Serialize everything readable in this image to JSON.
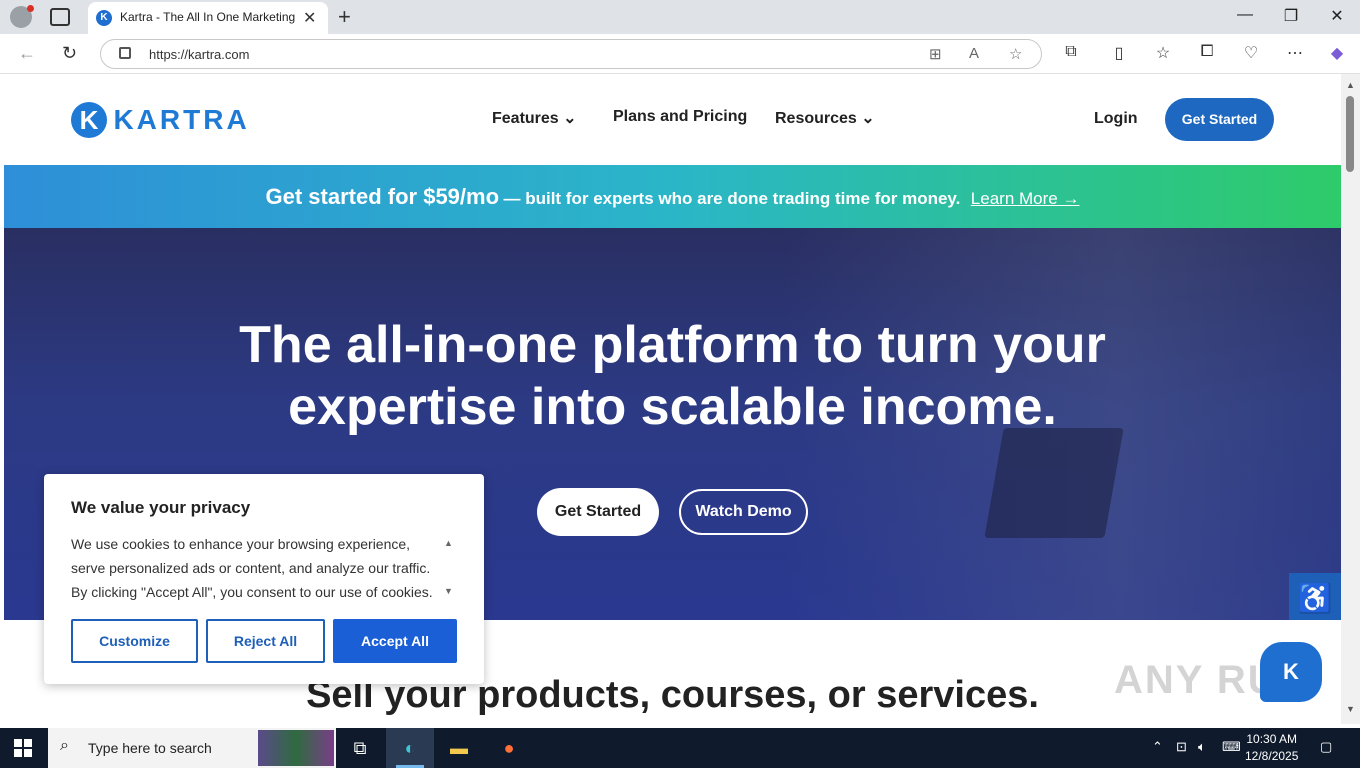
{
  "browser": {
    "tab_title": "Kartra - The All In One Marketing",
    "tab_favicon_letter": "K",
    "url": "https://kartra.com",
    "window_controls": [
      "—",
      "❐",
      "✕"
    ]
  },
  "header": {
    "logo_letter": "K",
    "logo_text": "KARTRA",
    "nav": [
      {
        "label": "Features",
        "has_dropdown": true
      },
      {
        "label": "Plans and Pricing",
        "has_dropdown": false
      },
      {
        "label": "Resources",
        "has_dropdown": true
      }
    ],
    "login_label": "Login",
    "cta_label": "Get Started"
  },
  "promo": {
    "bold": "Get started for $59/mo",
    "sub": "— built for experts who are done trading time for money.",
    "link": "Learn More →"
  },
  "hero": {
    "title_line1": "The all-in-one platform to turn your",
    "title_line2": "expertise into scalable income.",
    "primary_cta": "Get Started",
    "secondary_cta": "Watch Demo"
  },
  "section": {
    "heading": "Sell your products, courses, or services."
  },
  "cookie": {
    "title": "We value your privacy",
    "body": "We use cookies to enhance your browsing experience, serve personalized ads or content, and analyze our traffic. By clicking \"Accept All\", you consent to our use of cookies.",
    "customize": "Customize",
    "reject": "Reject All",
    "accept": "Accept All"
  },
  "widgets": {
    "chat_letter": "K",
    "watermark": "ANY RUN"
  },
  "taskbar": {
    "search_placeholder": "Type here to search",
    "time": "10:30 AM",
    "date": "12/8/2025"
  },
  "colors": {
    "brand_blue": "#1e68c1",
    "hero_bg": "#2c3a84",
    "promo_gradient_start": "#2e8fd8",
    "promo_gradient_end": "#2ecb6a"
  }
}
